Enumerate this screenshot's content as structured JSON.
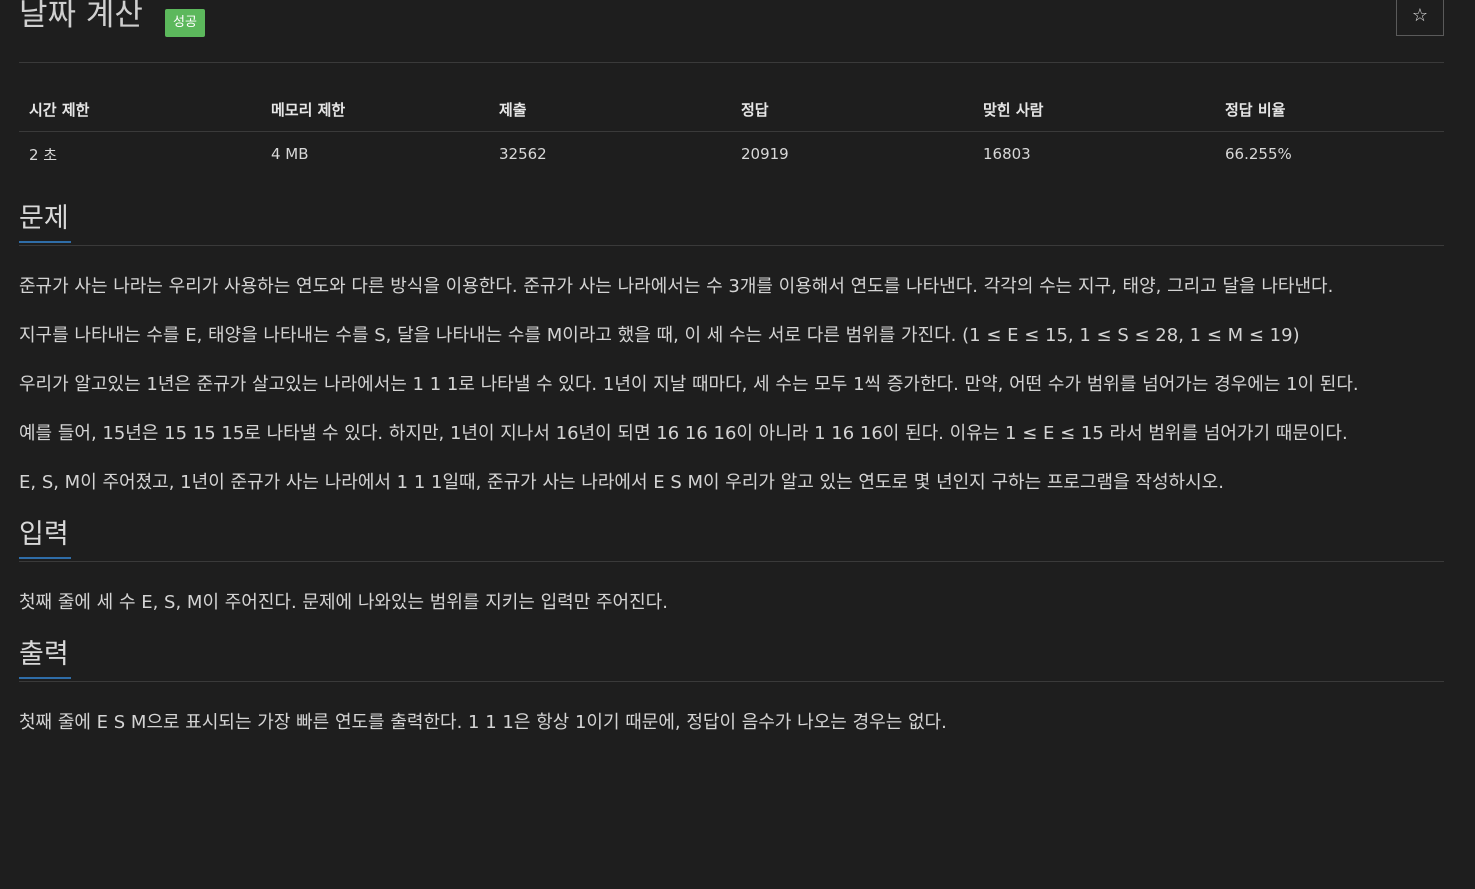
{
  "header": {
    "title": "날짜 계산",
    "badge": "성공",
    "star_label": "☆"
  },
  "stats": {
    "headers": [
      "시간 제한",
      "메모리 제한",
      "제출",
      "정답",
      "맞힌 사람",
      "정답 비율"
    ],
    "values": [
      "2 초",
      "4 MB",
      "32562",
      "20919",
      "16803",
      "66.255%"
    ]
  },
  "problem": {
    "heading": "문제",
    "paragraphs": [
      "준규가 사는 나라는 우리가 사용하는 연도와 다른 방식을 이용한다. 준규가 사는 나라에서는 수 3개를 이용해서 연도를 나타낸다. 각각의 수는 지구, 태양, 그리고 달을 나타낸다.",
      "지구를 나타내는 수를 E, 태양을 나타내는 수를 S, 달을 나타내는 수를 M이라고 했을 때, 이 세 수는 서로 다른 범위를 가진다. (1 ≤ E ≤ 15, 1 ≤ S ≤ 28, 1 ≤ M ≤ 19)",
      "우리가 알고있는 1년은 준규가 살고있는 나라에서는 1 1 1로 나타낼 수 있다. 1년이 지날 때마다, 세 수는 모두 1씩 증가한다. 만약, 어떤 수가 범위를 넘어가는 경우에는 1이 된다.",
      "예를 들어, 15년은 15 15 15로 나타낼 수 있다. 하지만, 1년이 지나서 16년이 되면 16 16 16이 아니라 1 16 16이 된다. 이유는 1 ≤ E ≤ 15 라서 범위를 넘어가기 때문이다.",
      "E, S, M이 주어졌고, 1년이 준규가 사는 나라에서 1 1 1일때, 준규가 사는 나라에서 E S M이 우리가 알고 있는 연도로 몇 년인지 구하는 프로그램을 작성하시오."
    ]
  },
  "input": {
    "heading": "입력",
    "text": "첫째 줄에 세 수 E, S, M이 주어진다. 문제에 나와있는 범위를 지키는 입력만 주어진다."
  },
  "output": {
    "heading": "출력",
    "text": "첫째 줄에 E S M으로 표시되는 가장 빠른 연도를 출력한다. 1 1 1은 항상 1이기 때문에, 정답이 음수가 나오는 경우는 없다."
  },
  "colors": {
    "background": "#1e1e1e",
    "success_badge": "#5cb85c",
    "heading_underline": "#2f6da8"
  }
}
